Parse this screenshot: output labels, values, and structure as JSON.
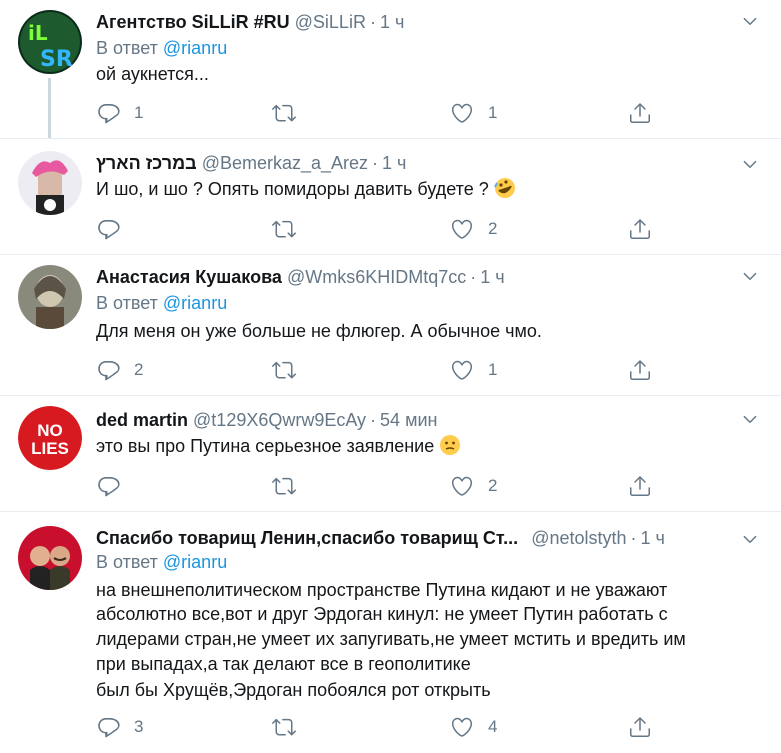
{
  "reply_prefix": "В ответ",
  "tweets": [
    {
      "name": "Агентство SiLLiR #RU",
      "handle": "@SiLLiR",
      "time": "1 ч",
      "reply_to": "@rianru",
      "text": "ой аукнется...",
      "replies": "1",
      "retweets": "",
      "likes": "1"
    },
    {
      "name": "במרכז הארץ",
      "handle": "@Bemerkaz_a_Arez",
      "time": "1 ч",
      "text": "И шо, и шо ? Опять помидоры давить будете ?",
      "emoji": "rolling-laughing-emoji",
      "replies": "",
      "retweets": "",
      "likes": "2"
    },
    {
      "name": "Анастасия Кушакова",
      "handle": "@Wmks6KHIDMtq7cc",
      "time": "1 ч",
      "reply_to": "@rianru",
      "text": "Для меня он уже больше не флюгер. А обычное чмо.",
      "replies": "2",
      "retweets": "",
      "likes": "1"
    },
    {
      "name": "ded martin",
      "handle": "@t129X6Qwrw9EcAy",
      "time": "54 мин",
      "text": "это вы про Путина серьезное заявление",
      "emoji": "thinking-face-emoji",
      "avatar_text": [
        "NO",
        "LIES"
      ],
      "replies": "",
      "retweets": "",
      "likes": "2"
    },
    {
      "name": "Спасибо товарищ Ленин,спасибо товарищ Ст...",
      "handle": "@netolstyth",
      "time": "1 ч",
      "reply_to": "@rianru",
      "text_lines": [
        "на внешнеполитическом пространстве Путина кидают и не уважают",
        "абсолютно все,вот и друг Эрдоган кинул: не умеет Путин работать с",
        "лидерами стран,не умеет их запугивать,не умеет мстить и вредить им",
        "при выпадах,а так делают все в геополитике",
        "был бы Хрущёв,Эрдоган побоялся рот открыть"
      ],
      "replies": "3",
      "retweets": "",
      "likes": "4"
    }
  ],
  "colors": {
    "accent": "#1b95e0",
    "muted": "#657786",
    "text": "#14171a",
    "divider": "#e6ecf0",
    "thread": "#ccd6dd"
  }
}
